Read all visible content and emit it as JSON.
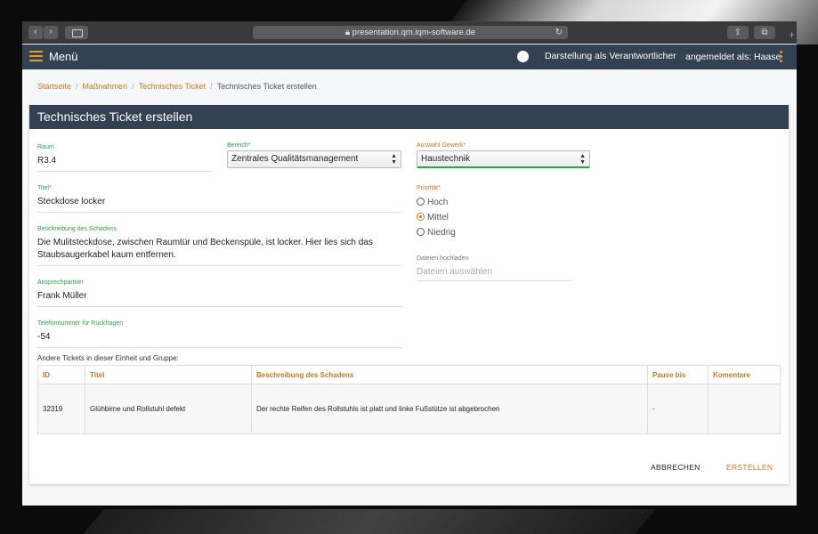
{
  "browser": {
    "url": "presentation.qm.iqm-software.de",
    "back_glyph": "‹",
    "forward_glyph": "›",
    "reload_glyph": "↻",
    "share_glyph": "⇪",
    "tabs_glyph": "⧉",
    "new_tab_glyph": "+"
  },
  "header": {
    "menu_label": "Menü",
    "toggle_label": "Darstellung als Verantwortlicher",
    "user_label": "angemeldet als: Haase"
  },
  "breadcrumb": {
    "items": [
      "Startseite",
      "Maßnahmen",
      "Technisches Ticket"
    ],
    "separator": "/",
    "current": "Technisches Ticket erstellen"
  },
  "form": {
    "title": "Technisches Ticket erstellen",
    "raum": {
      "label": "Raum",
      "value": "R3.4"
    },
    "bereich": {
      "label": "Bereich*",
      "value": "Zentrales Qualitätsmanagement"
    },
    "gewerk": {
      "label": "Auswahl Gewerk*",
      "value": "Haustechnik"
    },
    "titel": {
      "label": "Titel*",
      "value": "Steckdose locker"
    },
    "beschreibung": {
      "label": "Beschreibung des Schadens",
      "value": "Die Mulitsteckdose, zwischen Raumtür und Beckenspüle, ist locker. Hier lies sich das Staubsaugerkabel kaum entfernen."
    },
    "ansprechpartner": {
      "label": "Ansprechpartner",
      "value": "Frank Müller"
    },
    "telefon": {
      "label": "Telefonnummer für Rückfragen",
      "value": "-54"
    },
    "prioritaet": {
      "label": "Priorität*",
      "options": [
        "Hoch",
        "Mittel",
        "Niedrig"
      ],
      "selected": "Mittel"
    },
    "dateien": {
      "label": "Dateien hochladen",
      "placeholder": "Dateien auswählen"
    }
  },
  "tickets": {
    "label": "Andere Tickets in dieser Einheit und Gruppe:",
    "columns": [
      "ID",
      "Titel",
      "Beschreibung des Schadens",
      "Pause bis",
      "Komentare"
    ],
    "rows": [
      [
        "32319",
        "Glühbirne und Rollstuhl defekt",
        "Der rechte Reifen des Rollstuhls ist platt und linke Fußstütze ist abgebrochen",
        "-",
        ""
      ]
    ]
  },
  "actions": {
    "cancel": "ABBRECHEN",
    "create": "ERSTELLEN"
  },
  "colors": {
    "accent": "#c07a1e",
    "header_bg": "#334152",
    "label_green": "#2ea24a"
  }
}
